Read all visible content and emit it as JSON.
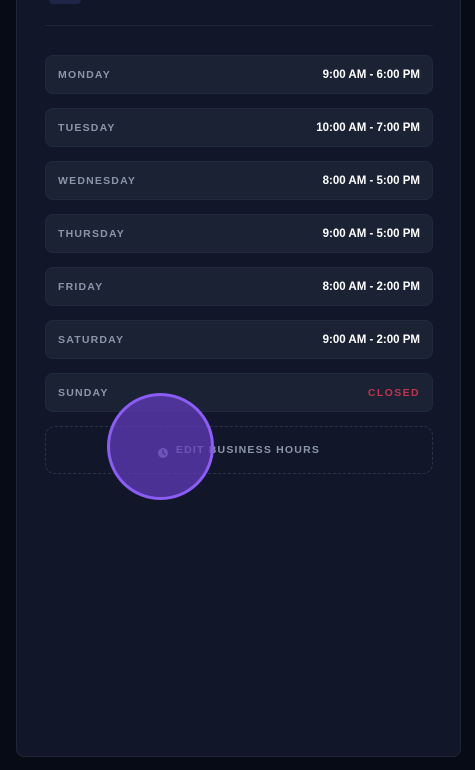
{
  "schedule": [
    {
      "day": "MONDAY",
      "hours": "9:00 AM - 6:00 PM",
      "closed": false
    },
    {
      "day": "TUESDAY",
      "hours": "10:00 AM - 7:00 PM",
      "closed": false
    },
    {
      "day": "WEDNESDAY",
      "hours": "8:00 AM - 5:00 PM",
      "closed": false
    },
    {
      "day": "THURSDAY",
      "hours": "9:00 AM - 5:00 PM",
      "closed": false
    },
    {
      "day": "FRIDAY",
      "hours": "8:00 AM - 2:00 PM",
      "closed": false
    },
    {
      "day": "SATURDAY",
      "hours": "9:00 AM - 2:00 PM",
      "closed": false
    },
    {
      "day": "SUNDAY",
      "hours": "CLOSED",
      "closed": true
    }
  ],
  "edit_button": {
    "label": "EDIT BUSINESS HOURS",
    "icon": "clock-icon"
  },
  "colors": {
    "background": "#070b16",
    "panel": "#111729",
    "row": "#1a2234",
    "closed": "#c0334f",
    "accent": "#8b5cf6"
  }
}
